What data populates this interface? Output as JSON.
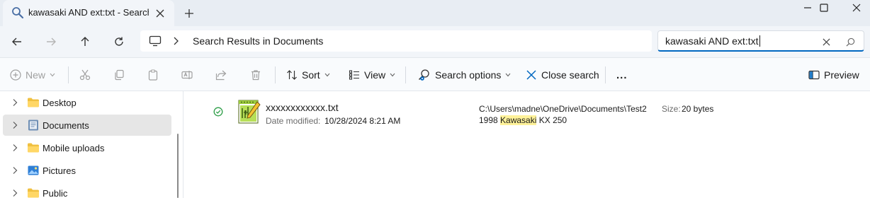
{
  "window": {
    "tab_title": "kawasaki AND ext:txt - Search Results in Documents",
    "tab_icon": "search-icon",
    "controls": [
      "minimize-icon",
      "maximize-icon",
      "close-icon"
    ]
  },
  "address": {
    "location_icon": "this-pc-icon",
    "path": "Search Results in Documents"
  },
  "search": {
    "value": "kawasaki AND ext:txt"
  },
  "commands": {
    "new": "New",
    "sort": "Sort",
    "view": "View",
    "search_options": "Search options",
    "close_search": "Close search",
    "more": "...",
    "preview": "Preview"
  },
  "nav": {
    "items": [
      {
        "label": "Desktop",
        "icon": "folder-icon"
      },
      {
        "label": "Documents",
        "icon": "documents-icon",
        "selected": true
      },
      {
        "label": "Mobile uploads",
        "icon": "folder-icon"
      },
      {
        "label": "Pictures",
        "icon": "pictures-icon"
      },
      {
        "label": "Public",
        "icon": "folder-icon"
      }
    ]
  },
  "results": [
    {
      "name": "xxxxxxxxxxxx.txt",
      "date_label": "Date modified:",
      "date_value": "10/28/2024 8:21 AM",
      "path": "C:\\Users\\madne\\OneDrive\\Documents\\Test2",
      "snippet_before": "1998 ",
      "snippet_highlight": "Kawasaki",
      "snippet_after": " KX 250",
      "size_label": "Size:",
      "size_value": "20 bytes",
      "status": "synced"
    }
  ],
  "colors": {
    "accent": "#0067c0",
    "highlight": "#fff29a",
    "selected_row": "#e6e6e6",
    "folder": "#f0c040",
    "sync_ok": "#2e9e48"
  }
}
